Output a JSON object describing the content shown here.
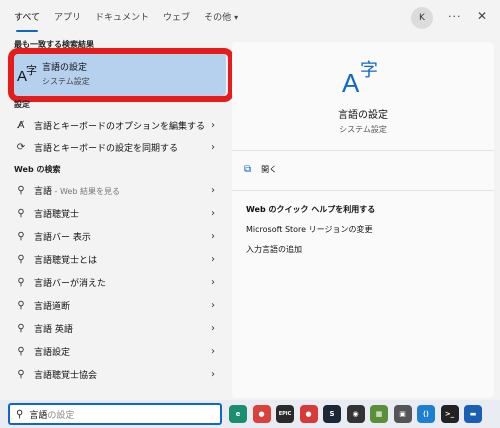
{
  "tabs": [
    {
      "label": "すべて"
    },
    {
      "label": "アプリ"
    },
    {
      "label": "ドキュメント"
    },
    {
      "label": "ウェブ"
    },
    {
      "label": "その他"
    }
  ],
  "header": {
    "avatar_letter": "K",
    "more": "···",
    "close": "✕"
  },
  "best_match": {
    "heading": "最も一致する検索結果",
    "title": "言語の設定",
    "subtitle": "システム設定"
  },
  "settings": {
    "heading": "設定",
    "items": [
      {
        "label": "言語とキーボードのオプションを編集する",
        "icon": "keyboard-language-icon"
      },
      {
        "label": "言語とキーボードの設定を同期する",
        "icon": "sync-icon"
      }
    ]
  },
  "web_search": {
    "heading": "Web の検索",
    "items": [
      {
        "label": "言語",
        "suffix": " - Web 結果を見る"
      },
      {
        "label": "言語聴覚士",
        "suffix": ""
      },
      {
        "label": "言語バー 表示",
        "suffix": ""
      },
      {
        "label": "言語聴覚士とは",
        "suffix": ""
      },
      {
        "label": "言語バーが消えた",
        "suffix": ""
      },
      {
        "label": "言語道断",
        "suffix": ""
      },
      {
        "label": "言語 英語",
        "suffix": ""
      },
      {
        "label": "言語設定",
        "suffix": ""
      },
      {
        "label": "言語聴覚士協会",
        "suffix": ""
      }
    ]
  },
  "detail": {
    "title": "言語の設定",
    "subtitle": "システム設定",
    "open_label": "開く",
    "web_heading": "Web のクイック ヘルプを利用する",
    "web_links": [
      "Microsoft Store リージョンの変更",
      "入力言語の追加"
    ]
  },
  "search": {
    "typed": "言語",
    "completion": "の設定"
  },
  "taskbar_icons": [
    {
      "name": "edge-icon",
      "color": "#1a8f6e",
      "glyph": "e"
    },
    {
      "name": "chrome-icon",
      "color": "#d9413a",
      "glyph": "●"
    },
    {
      "name": "epic-games-icon",
      "color": "#2a2a2a",
      "glyph": "EPIC"
    },
    {
      "name": "red-app-icon",
      "color": "#d83a3a",
      "glyph": "●"
    },
    {
      "name": "steam-icon",
      "color": "#1b2838",
      "glyph": "S"
    },
    {
      "name": "obs-icon",
      "color": "#333333",
      "glyph": "◉"
    },
    {
      "name": "minecraft-icon",
      "color": "#5a8f3a",
      "glyph": "▦"
    },
    {
      "name": "twitch-like-icon",
      "color": "#555555",
      "glyph": "▣"
    },
    {
      "name": "vscode-icon",
      "color": "#1e7fd1",
      "glyph": "⟨⟩"
    },
    {
      "name": "terminal-icon",
      "color": "#222222",
      "glyph": ">_"
    },
    {
      "name": "blue-app-icon",
      "color": "#1a5fb4",
      "glyph": "▬"
    }
  ]
}
